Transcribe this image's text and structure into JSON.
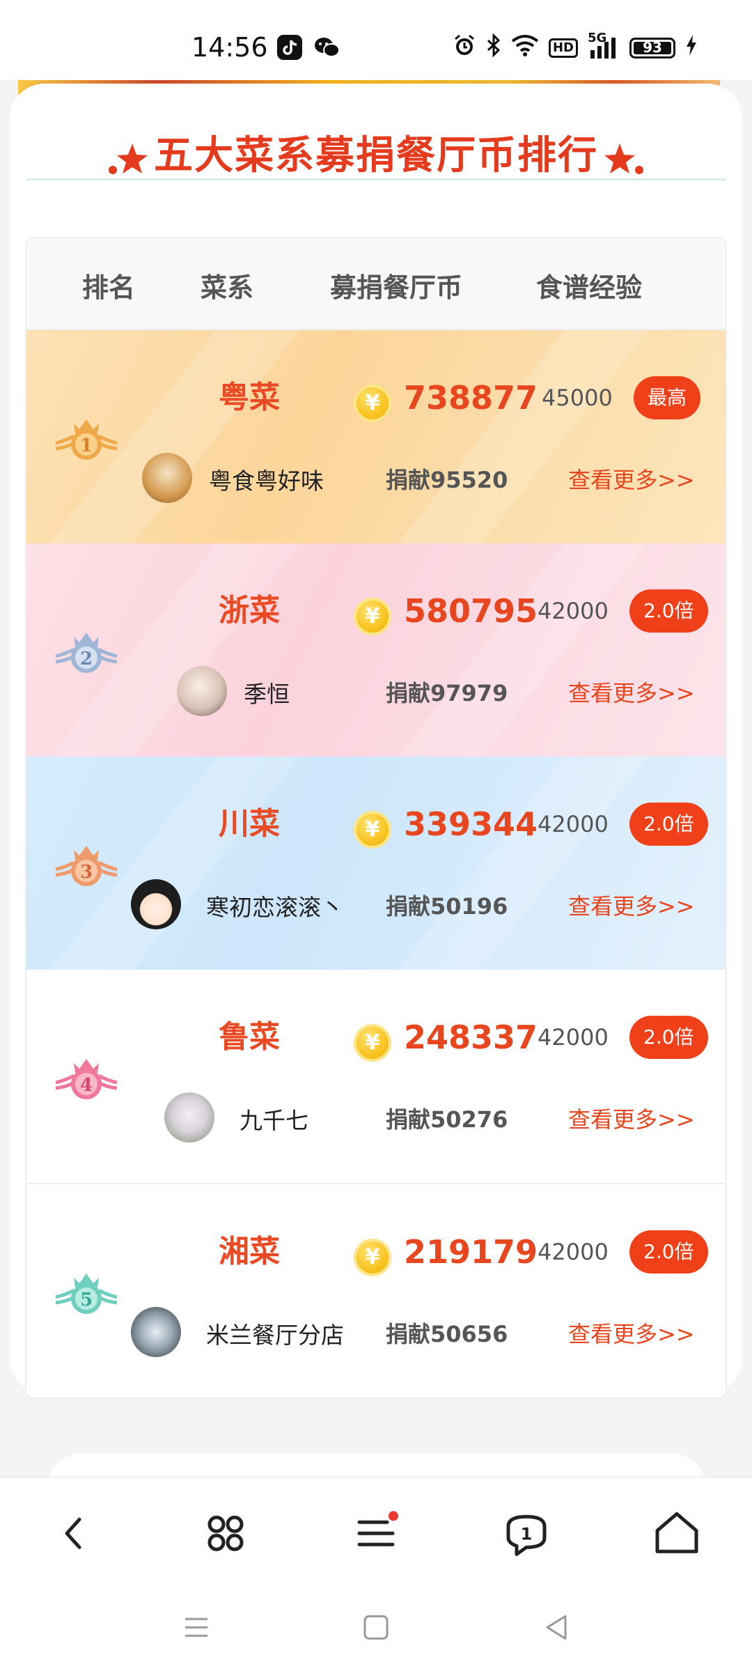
{
  "status_bar": {
    "time": "14:56",
    "battery": "93",
    "hd": "HD",
    "network": "5G",
    "icons": [
      "tiktok-icon",
      "wechat-icon",
      "alarm-icon",
      "bluetooth-icon",
      "wifi-icon",
      "signal-icon",
      "battery-icon",
      "charging-icon"
    ]
  },
  "ranking": {
    "title": "五大菜系募捐餐厅币排行",
    "headers": {
      "rank": "排名",
      "cuisine": "菜系",
      "coins": "募捐餐厅币",
      "exp": "食谱经验"
    },
    "rows": [
      {
        "rank": "1",
        "cuisine": "粤菜",
        "coins": "738877",
        "exp": "45000",
        "badge": "最高",
        "user": "粤食粤好味",
        "donation": "捐献95520",
        "more": "查看更多>>",
        "medal_color": "#f0a94a"
      },
      {
        "rank": "2",
        "cuisine": "浙菜",
        "coins": "580795",
        "exp": "42000",
        "badge": "2.0倍",
        "user": "季恒",
        "donation": "捐献97979",
        "more": "查看更多>>",
        "medal_color": "#9fb6d6"
      },
      {
        "rank": "3",
        "cuisine": "川菜",
        "coins": "339344",
        "exp": "42000",
        "badge": "2.0倍",
        "user": "寒初恋滚滚丶",
        "donation": "捐献50196",
        "more": "查看更多>>",
        "medal_color": "#ef9a6a"
      },
      {
        "rank": "4",
        "cuisine": "鲁菜",
        "coins": "248337",
        "exp": "42000",
        "badge": "2.0倍",
        "user": "九千七",
        "donation": "捐献50276",
        "more": "查看更多>>",
        "medal_color": "#f0789a"
      },
      {
        "rank": "5",
        "cuisine": "湘菜",
        "coins": "219179",
        "exp": "42000",
        "badge": "2.0倍",
        "user": "米兰餐厅分店",
        "donation": "捐献50656",
        "more": "查看更多>>",
        "medal_color": "#6fcfbf"
      }
    ],
    "coin_symbol": "¥"
  },
  "browser_nav": {
    "tab_count": "1",
    "icons": [
      "back-icon",
      "apps-icon",
      "menu-icon",
      "tabs-icon",
      "home-icon"
    ]
  },
  "system_nav": {
    "icons": [
      "recents-icon",
      "home-square-icon",
      "back-triangle-icon"
    ]
  },
  "colors": {
    "accent": "#e8461e",
    "badge": "#f0401a",
    "row1": "#fcd59a",
    "row2": "#fcd3dd",
    "row3": "#cde6fb"
  }
}
